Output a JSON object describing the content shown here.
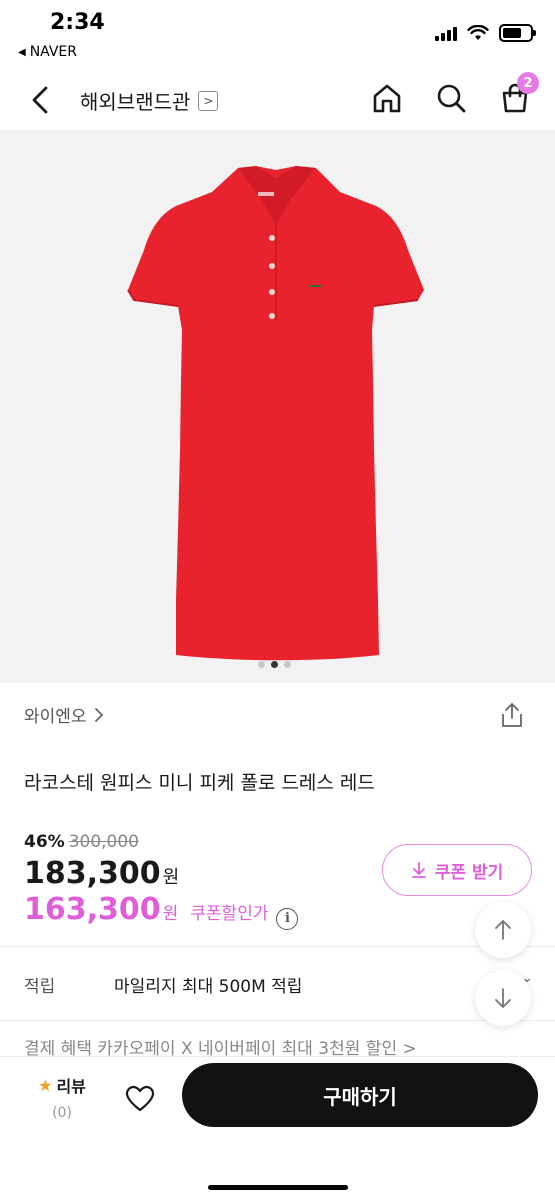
{
  "status_bar": {
    "time": "2:34",
    "back_app": "NAVER"
  },
  "header": {
    "title": "해외브랜드관",
    "cart_count": "2",
    "icons": [
      "back-icon",
      "home-icon",
      "search-icon",
      "shopping-bag-icon"
    ]
  },
  "product": {
    "image_color": "#e8232e",
    "carousel": {
      "total": 3,
      "active": 2
    },
    "brand": "와이엔오",
    "name": "라코스테 원피스 미니 피케 폴로 드레스 레드",
    "discount_rate": "46%",
    "original_price": "300,000",
    "sale_price": "183,300",
    "sale_currency": "원",
    "coupon_price": "163,300",
    "coupon_currency": "원",
    "coupon_price_label": "쿠폰할인가",
    "coupon_button": "쿠폰 받기",
    "accent_color": "#e05fd9"
  },
  "benefits": {
    "mileage_label": "적립",
    "mileage_value": "마일리지 최대 500M 적립",
    "next_row_cut": "결제 혜택     카카오페이 X 네이버페이 최대 3천원 할인 >"
  },
  "bottom_bar": {
    "review_label": "리뷰",
    "review_count": "(0)",
    "buy_label": "구매하기"
  }
}
